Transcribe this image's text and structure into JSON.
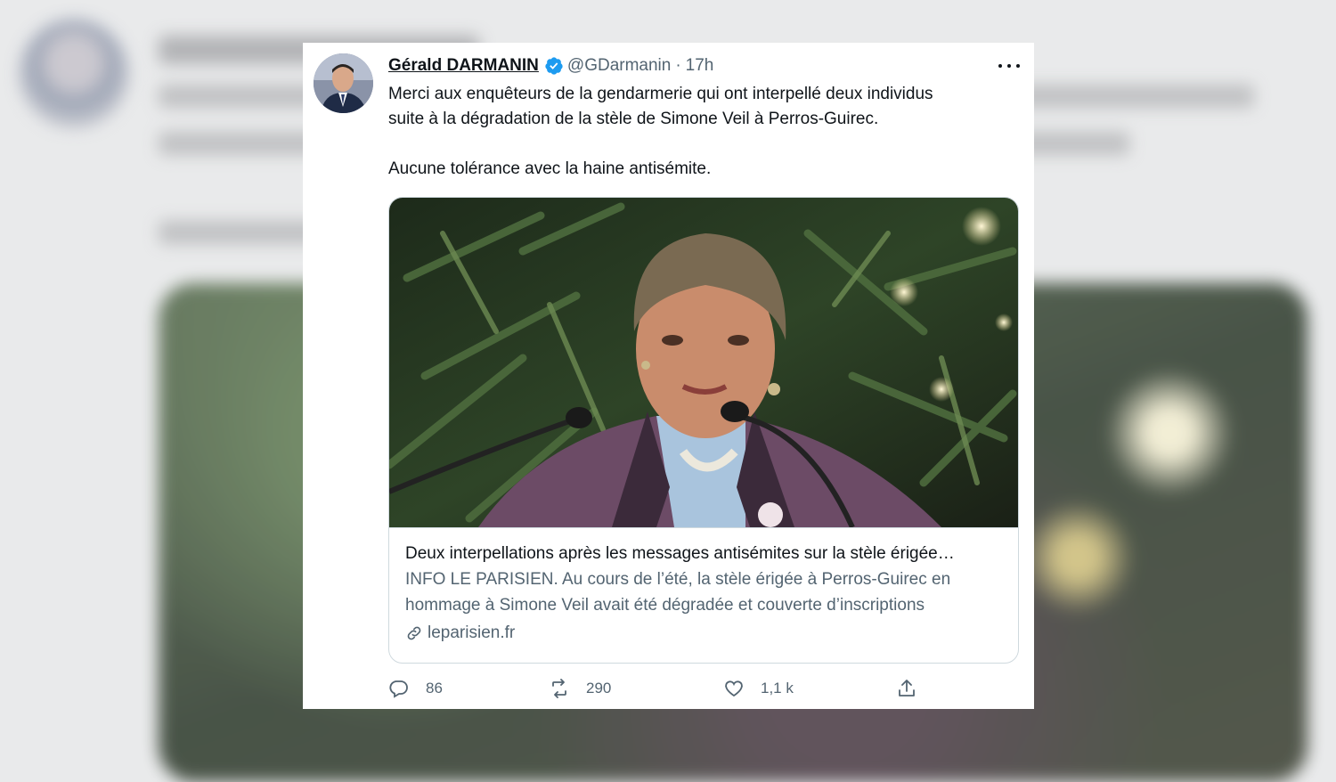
{
  "tweet": {
    "author_name": "Gérald DARMANIN",
    "handle": "@GDarmanin",
    "separator": "·",
    "time": "17h",
    "text_line1": "Merci aux enquêteurs de la gendarmerie qui ont interpellé deux individus",
    "text_line2": "suite à la dégradation de la stèle de Simone Veil à Perros-Guirec.",
    "text_line3": "Aucune tolérance avec la haine antisémite.",
    "link_card": {
      "title": "Deux interpellations après les messages antisémites sur la stèle érigée…",
      "description_line1": "INFO LE PARISIEN. Au cours de l’été, la stèle érigée à Perros-Guirec en",
      "description_line2": "hommage à Simone Veil avait été dégradée et couverte d’inscriptions",
      "domain": "leparisien.fr"
    },
    "actions": {
      "replies": "86",
      "retweets": "290",
      "likes": "1,1 k"
    }
  },
  "icons": [
    "verified-badge-icon",
    "more-options-icon",
    "link-icon",
    "reply-icon",
    "retweet-icon",
    "like-icon",
    "share-icon"
  ],
  "colors": {
    "verified_blue": "#1d9bf0",
    "text_primary": "#0f1419",
    "text_secondary": "#536471",
    "border": "#cfd9de"
  }
}
